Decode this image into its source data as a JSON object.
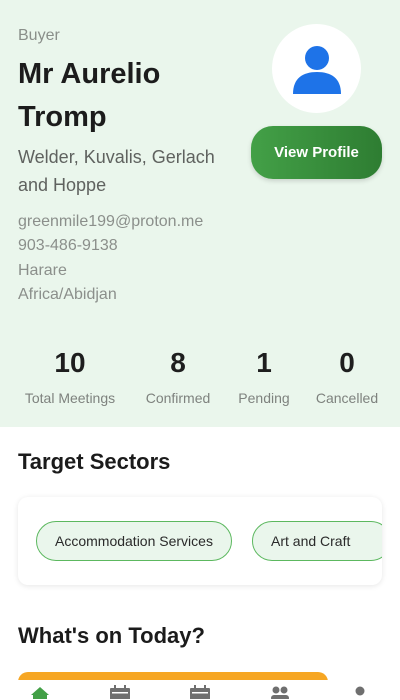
{
  "profile": {
    "role": "Buyer",
    "name": "Mr Aurelio Tromp",
    "company": "Welder, Kuvalis, Gerlach and Hoppe",
    "email": "greenmile199@proton.me",
    "phone": "903-486-9138",
    "city": "Harare",
    "timezone": "Africa/Abidjan",
    "avatar_icon": "user-icon",
    "view_profile_label": "View Profile"
  },
  "stats": [
    {
      "value": "10",
      "label": "Total Meetings"
    },
    {
      "value": "8",
      "label": "Confirmed"
    },
    {
      "value": "1",
      "label": "Pending"
    },
    {
      "value": "0",
      "label": "Cancelled"
    }
  ],
  "sectors": {
    "title": "Target Sectors",
    "items": [
      "Accommodation Services",
      "Art and Craft"
    ]
  },
  "today": {
    "title": "What's on Today?"
  },
  "nav": {
    "items": [
      {
        "icon": "home-icon",
        "active": true
      },
      {
        "icon": "calendar-icon",
        "active": false
      },
      {
        "icon": "calendar-icon",
        "active": false
      },
      {
        "icon": "people-icon",
        "active": false
      },
      {
        "icon": "more-icon",
        "active": false
      }
    ]
  },
  "colors": {
    "accent": "#43a047",
    "hero_bg": "#eaf6ec",
    "avatar_blue": "#1e73e8",
    "today_bar": "#f6a623"
  }
}
